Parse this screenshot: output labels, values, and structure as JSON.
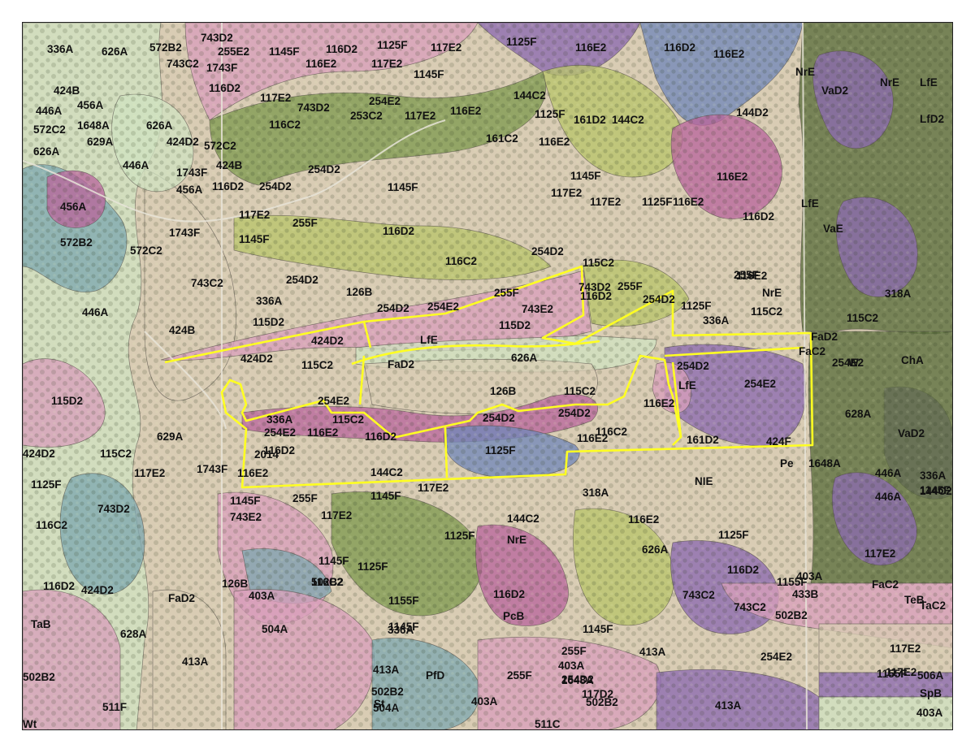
{
  "map": {
    "colors": {
      "field": "#d9ccb4",
      "forest_green": "#7f9a4f",
      "forest_dark": "#5b6e3c",
      "soil_pink": "#d89fbb",
      "soil_magenta": "#b9669c",
      "soil_purple": "#8c6ab0",
      "soil_teal": "#7fa8b0",
      "soil_yellowgreen": "#b9c46a",
      "soil_blue": "#7288b8",
      "soil_light": "#cfe2c0",
      "boundary": "#ffff22"
    },
    "soil_labels": [
      "336A",
      "626A",
      "572B2",
      "743D2",
      "255E2",
      "1145F",
      "116D2",
      "1125F",
      "117E2",
      "1125F",
      "116E2",
      "116D2",
      "116E2",
      "743C2",
      "1743F",
      "116E2",
      "117E2",
      "1145F",
      "424B",
      "456A",
      "446A",
      "1648A",
      "572C2",
      "629A",
      "626A",
      "116D2",
      "117E2",
      "743D2",
      "254E2",
      "253C2",
      "117E2",
      "116E2",
      "144C2",
      "1125F",
      "161D2",
      "144C2",
      "116C2",
      "424D2",
      "572C2",
      "161C2",
      "116E2",
      "NrE",
      "VaD2",
      "NrE",
      "LfE",
      "LfD2",
      "144D2",
      "626A",
      "446A",
      "424B",
      "1743F",
      "456A",
      "254D2",
      "116D2",
      "254D2",
      "1145F",
      "1145F",
      "117E2",
      "117E2",
      "116E2",
      "1125F",
      "116E2",
      "116D2",
      "255F",
      "117E2",
      "1145F",
      "116D2",
      "456A",
      "LfE",
      "VaE",
      "1743F",
      "572B2",
      "572C2",
      "116C2",
      "254D2",
      "115C2",
      "743C2",
      "254D2",
      "126B",
      "254D2",
      "254E2",
      "255F",
      "743E2",
      "743D2",
      "255F",
      "115D2",
      "254D2",
      "1125F",
      "255F",
      "116E2",
      "NrE",
      "318A",
      "336A",
      "446A",
      "424B",
      "115D2",
      "116D2",
      "115C2",
      "LfE",
      "115C2",
      "336A",
      "424D2",
      "115C2",
      "424D2",
      "626A",
      "FaD2",
      "FaC2",
      "254E2",
      "W",
      "ChA",
      "FaD2",
      "126B",
      "115C2",
      "254D2",
      "254E2",
      "116E2",
      "628A",
      "115D2",
      "254E2",
      "LfE",
      "336A",
      "115C2",
      "254D2",
      "116D2",
      "VaD2",
      "629A",
      "254E2",
      "116E2",
      "116D2",
      "254D2",
      "116C2",
      "116E2",
      "1125F",
      "161D2",
      "424F",
      "424D2",
      "115C2",
      "1743F",
      "116E2",
      "2014",
      "Pe",
      "1648A",
      "117E2",
      "144C2",
      "NIE",
      "336A",
      "1125F",
      "446A",
      "743D2",
      "1145F",
      "255F",
      "1145F",
      "117E2",
      "446A",
      "743E2",
      "117E2",
      "1145F",
      "318A",
      "144C2",
      "116E2",
      "1125F",
      "116D2",
      "116C2",
      "1125F",
      "1125F",
      "144C2",
      "NrE",
      "626A",
      "117E2",
      "1145F",
      "116D2",
      "424D2",
      "126B",
      "403A",
      "502B2",
      "743C2",
      "1155F",
      "403A",
      "FaC2",
      "FaD2",
      "433B",
      "TeB",
      "TaC2",
      "TaB",
      "336A",
      "1145F",
      "116C2",
      "743C2",
      "502B2",
      "628A",
      "504A",
      "1145F",
      "1155F",
      "116D2",
      "PcB",
      "413A",
      "255F",
      "117E2",
      "502B2",
      "PfD",
      "413A",
      "254E2",
      "1155F",
      "255F",
      "403A",
      "254D2",
      "SpB",
      "117E2",
      "502B2",
      "413A",
      "1648A",
      "117D2",
      "506A",
      "St",
      "403A",
      "502B2",
      "511F",
      "504A",
      "413A",
      "403A",
      "511C",
      "Wt"
    ]
  }
}
